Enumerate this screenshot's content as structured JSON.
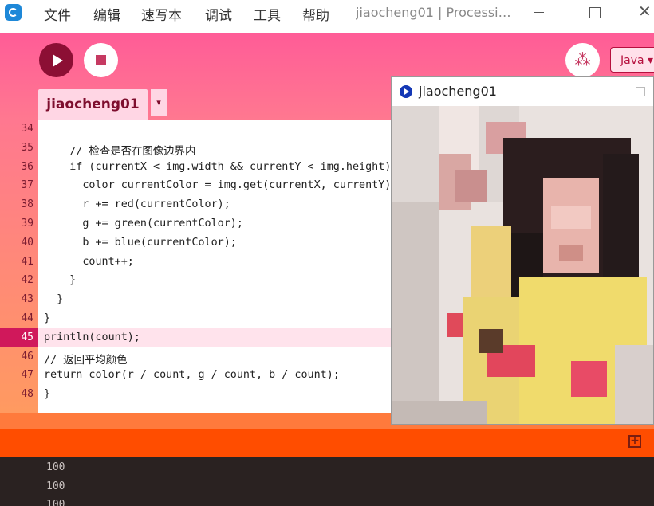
{
  "titlebar": {
    "menus": [
      "文件",
      "编辑",
      "速写本",
      "调试",
      "工具",
      "帮助"
    ],
    "window_title": "jiaocheng01 | Processi…",
    "close_glyph": "✕"
  },
  "toolbar": {
    "run_icon": "play-icon",
    "stop_icon": "stop-icon",
    "debug_label": "⁂",
    "mode_label": "Java ▾"
  },
  "tab": {
    "name": "jiaocheng01",
    "menu_glyph": "▾"
  },
  "editor": {
    "current_line": 45,
    "lines": [
      {
        "n": "34",
        "code": ""
      },
      {
        "n": "35",
        "code": "    // 检查是否在图像边界内"
      },
      {
        "n": "36",
        "code": "    if (currentX < img.width && currentY < img.height) {"
      },
      {
        "n": "37",
        "code": "      color currentColor = img.get(currentX, currentY);"
      },
      {
        "n": "38",
        "code": "      r += red(currentColor);"
      },
      {
        "n": "39",
        "code": "      g += green(currentColor);"
      },
      {
        "n": "40",
        "code": "      b += blue(currentColor);"
      },
      {
        "n": "41",
        "code": "      count++;"
      },
      {
        "n": "42",
        "code": "    }"
      },
      {
        "n": "43",
        "code": "  }"
      },
      {
        "n": "44",
        "code": "}"
      },
      {
        "n": "45",
        "code": "println(count);"
      },
      {
        "n": "46",
        "code": "// 返回平均颜色"
      },
      {
        "n": "47",
        "code": "return color(r / count, g / count, b / count);"
      },
      {
        "n": "48",
        "code": "}"
      }
    ]
  },
  "console": {
    "lines": [
      "100",
      "100",
      "100"
    ]
  },
  "sketch_window": {
    "title": "jiaocheng01"
  },
  "colors": {
    "accent": "#ff5c97",
    "run": "#8c0f34",
    "console_bg": "#2a2221",
    "status": "#ff4d00"
  }
}
